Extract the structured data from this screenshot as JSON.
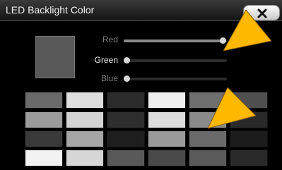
{
  "header": {
    "title": "LED Backlight Color",
    "close_icon": "close-icon"
  },
  "preview": {
    "color": "#595959"
  },
  "sliders": [
    {
      "label": "Red",
      "level": 0.96,
      "label_color": "#7d7d7d"
    },
    {
      "label": "Green",
      "level": 0.03,
      "label_color": "#f0f0f0"
    },
    {
      "label": "Blue",
      "level": 0.03,
      "label_color": "#7d7d7d"
    }
  ],
  "swatches": [
    [
      "#6a6a6a",
      "#dedede",
      "#2c2c2c",
      "#efefef",
      "#6e6e6e",
      "#4f4f4f"
    ],
    [
      "#9c9c9c",
      "#d4d4d4",
      "#2e2e2e",
      "#dcdcdc",
      "#8a8a8a",
      "#2a2a2a"
    ],
    [
      "#3a3a3a",
      "#a6a6a6",
      "#1e1e1e",
      "#9a9a9a",
      "#6a6a6a",
      "#1c1c1c"
    ],
    [
      "#f2f2f2",
      "#d6d6d6",
      "#595959",
      "#4a4a4a",
      "#5a5a5a",
      "#2a2a2a"
    ]
  ],
  "accent": "#ffb800"
}
